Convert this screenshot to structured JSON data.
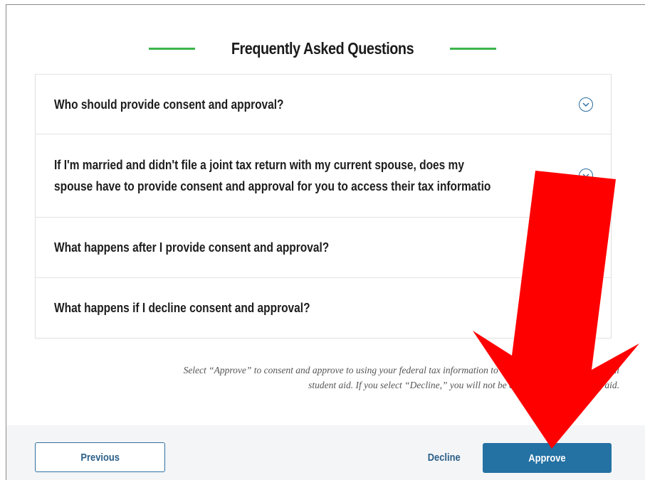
{
  "faq": {
    "title": "Frequently Asked Questions",
    "accent_color": "#3bb54a",
    "items": [
      {
        "question_lines": [
          "Who should provide consent and approval?"
        ],
        "icon": "chevron-down-circle-icon"
      },
      {
        "question_lines": [
          "If I'm married and didn't file a joint tax return with my current spouse, does my",
          "spouse have to provide consent and approval for you to access their tax informatio"
        ],
        "icon": "chevron-down-circle-icon"
      },
      {
        "question_lines": [
          "What happens after I provide consent and approval?"
        ],
        "icon": "chevron-down-circle-icon"
      },
      {
        "question_lines": [
          "What happens if I decline consent and approval?"
        ],
        "icon": "chevron-down-circle-icon"
      }
    ]
  },
  "disclaimer": {
    "line1": "Select “Approve” to consent and approve to using your federal tax information to determine your",
    "line1_tail": "al",
    "line2": "student aid. If you select “Decline,” you will not be eligible for f",
    "line2_tail": "aid."
  },
  "footer": {
    "previous_label": "Previous",
    "decline_label": "Decline",
    "approve_label": "Approve",
    "primary_color": "#2471a3"
  },
  "annotation": {
    "arrow_color": "#ff0000",
    "icon": "red-arrow-down-icon"
  }
}
